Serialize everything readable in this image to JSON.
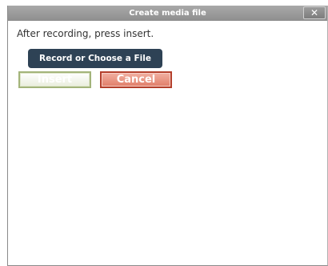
{
  "dialog": {
    "title": "Create media file",
    "close_label": "✕",
    "instruction": "After recording, press insert.",
    "record_button_label": "Record or Choose a File",
    "insert_button_label": "Insert",
    "cancel_button_label": "Cancel"
  },
  "colors": {
    "titlebar": "#8e8e8e",
    "record_button": "#2e4255",
    "insert_border": "#a3b47a",
    "cancel_border": "#b4402c"
  }
}
